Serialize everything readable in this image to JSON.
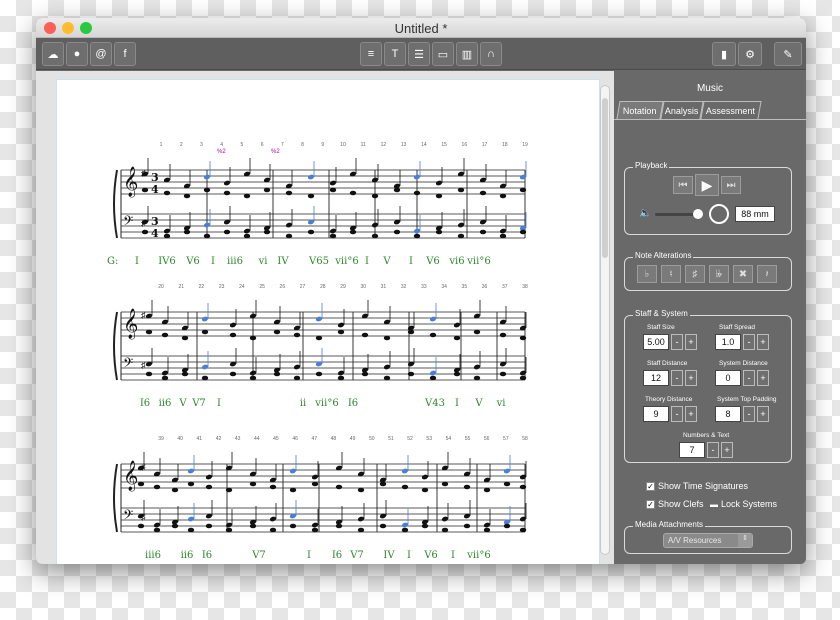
{
  "window": {
    "title": "Untitled *"
  },
  "toolbar": {
    "left": [
      {
        "name": "cloud-icon",
        "glyph": "☁"
      },
      {
        "name": "chat-icon",
        "glyph": "●"
      },
      {
        "name": "at-icon",
        "glyph": "@"
      },
      {
        "name": "facebook-icon",
        "glyph": "f"
      }
    ],
    "center": [
      {
        "name": "playback-list-icon",
        "glyph": "≡"
      },
      {
        "name": "text-tool-icon",
        "glyph": "T"
      },
      {
        "name": "list-icon",
        "glyph": "☰"
      },
      {
        "name": "image-icon",
        "glyph": "▭"
      },
      {
        "name": "film-icon",
        "glyph": "▥"
      },
      {
        "name": "headphones-icon",
        "glyph": "∩"
      }
    ],
    "right": [
      {
        "name": "book-icon",
        "glyph": "▮"
      },
      {
        "name": "gear-icon",
        "glyph": "⚙"
      },
      {
        "name": "pencil-icon",
        "glyph": "✎"
      }
    ]
  },
  "panel": {
    "title": "Music",
    "tabs": [
      "Notation",
      "Analysis",
      "Assessment"
    ],
    "playback": {
      "label": "Playback",
      "width_value": "88 mm"
    },
    "alterations": {
      "label": "Note Alterations",
      "glyphs": [
        "♭",
        "♮",
        "♯",
        "𝄫",
        "✖",
        "𝄽"
      ]
    },
    "staff": {
      "label": "Staff & System",
      "staff_size_label": "Staff Size",
      "staff_size": "5.00",
      "staff_spread_label": "Staff Spread",
      "staff_spread": "1.0",
      "staff_distance_label": "Staff Distance",
      "staff_distance": "12",
      "system_distance_label": "System Distance",
      "system_distance": "0",
      "theory_distance_label": "Theory Distance",
      "theory_distance": "9",
      "top_padding_label": "System Top Padding",
      "top_padding": "8",
      "numbers_text_label": "Numbers & Text",
      "numbers_text": "7",
      "minus": "-",
      "plus": "+"
    },
    "show_time_signatures": "Show Time Signatures",
    "show_clefs": "Show Clefs",
    "lock_systems": "Lock Systems",
    "media": {
      "label": "Media Attachments",
      "select": "A/V Resources"
    }
  },
  "score": {
    "key_label": "G:",
    "systems": [
      {
        "measure_numbers": [
          "1",
          "2",
          "3",
          "4",
          "5",
          "6",
          "7",
          "8",
          "9",
          "10",
          "11",
          "12",
          "13",
          "14",
          "15",
          "16",
          "17",
          "18",
          "19"
        ],
        "annotations": [
          "%2",
          "%2"
        ],
        "chords": [
          "I",
          "IV6",
          "V6",
          "I",
          "iii6",
          "vi",
          "IV",
          "V65",
          "vii°6",
          "I",
          "V",
          "I",
          "V6",
          "vi6",
          "vii°6"
        ]
      },
      {
        "measure_numbers": [
          "20",
          "21",
          "22",
          "23",
          "24",
          "25",
          "26",
          "27",
          "28",
          "29",
          "30",
          "31",
          "32",
          "33",
          "34",
          "35",
          "36",
          "37",
          "38"
        ],
        "chords": [
          "I6",
          "ii6",
          "V",
          "V7",
          "I",
          "ii",
          "vii°6",
          "I6",
          "V43",
          "I",
          "V",
          "vi"
        ]
      },
      {
        "measure_numbers": [
          "39",
          "40",
          "41",
          "42",
          "43",
          "44",
          "45",
          "46",
          "47",
          "48",
          "49",
          "50",
          "51",
          "52",
          "53",
          "54",
          "55",
          "56",
          "57",
          "58"
        ],
        "chords": [
          "iii6",
          "ii6",
          "I6",
          "V7",
          "I",
          "I6",
          "V7",
          "IV",
          "I",
          "V6",
          "I",
          "vii°6"
        ]
      }
    ]
  }
}
